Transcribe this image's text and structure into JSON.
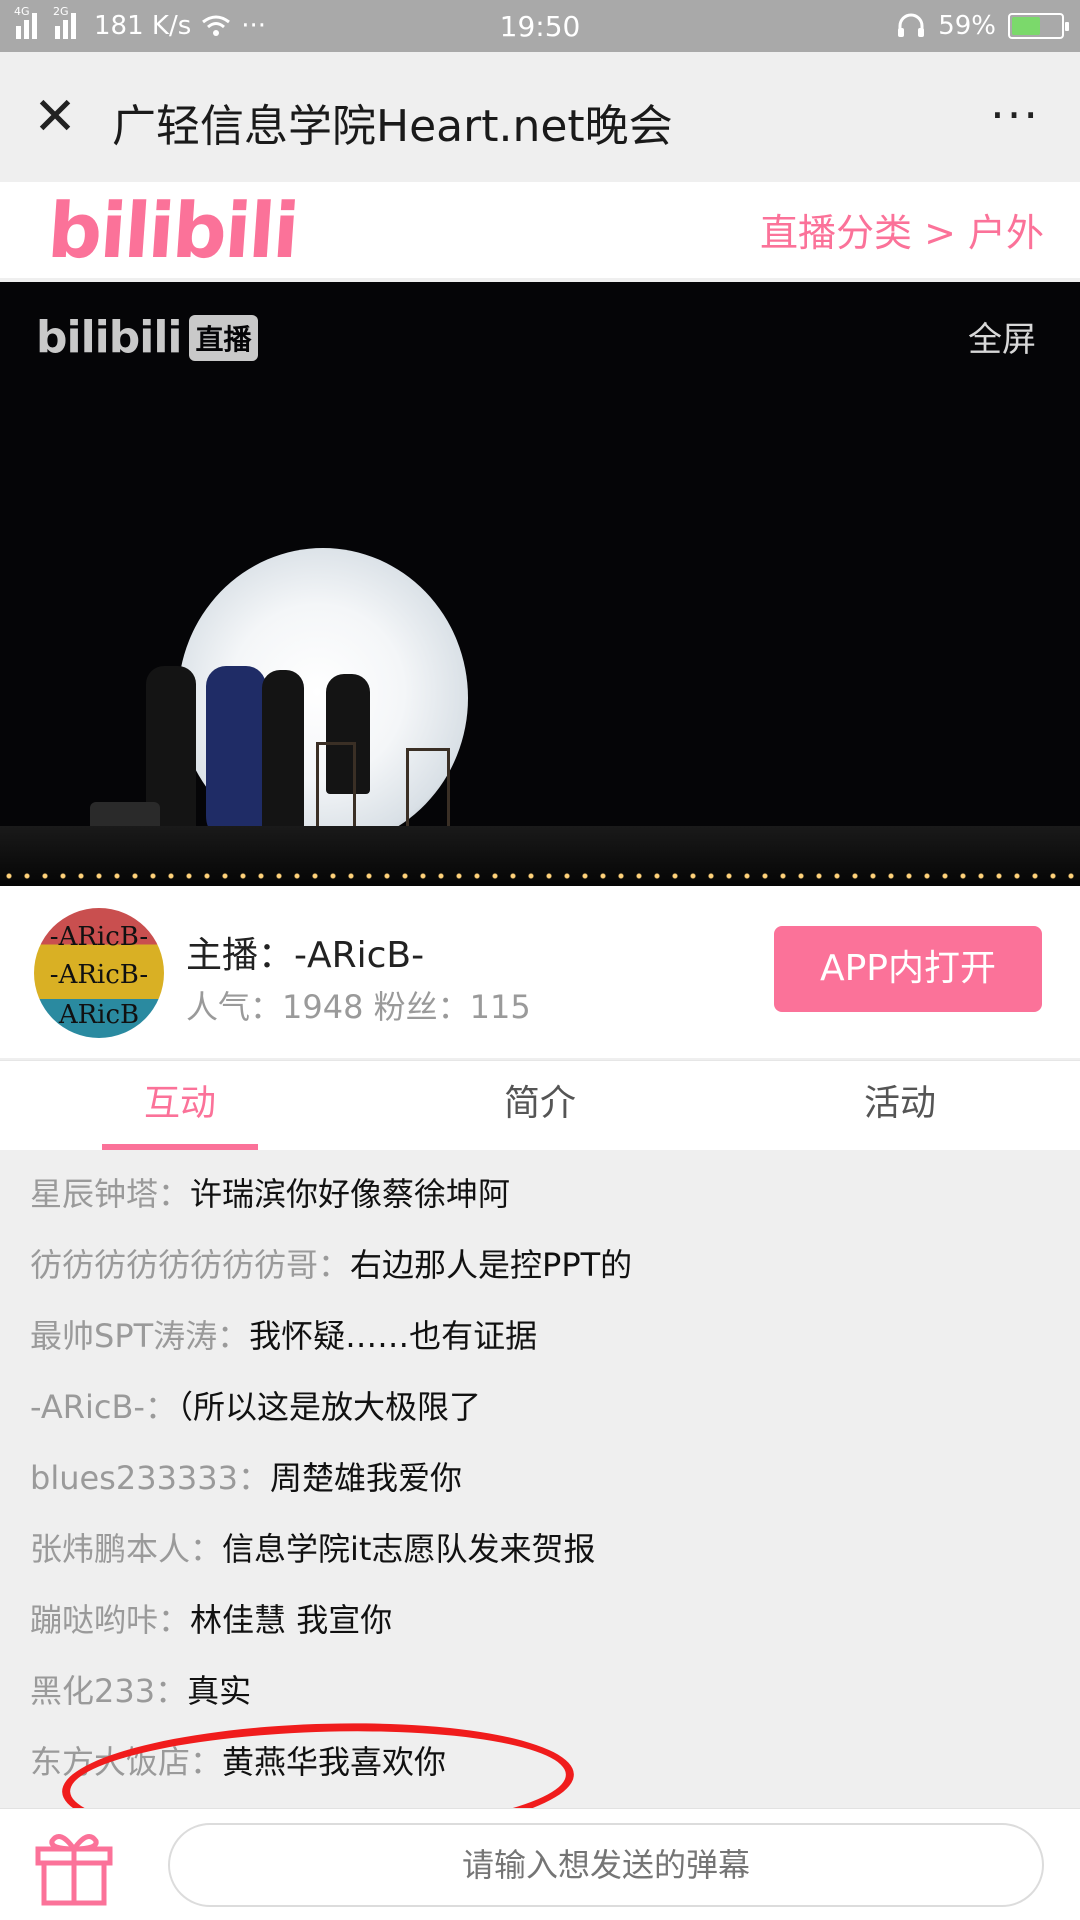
{
  "status_bar": {
    "network_1": "4G",
    "network_2": "2G",
    "speed": "181 K/s",
    "more": "···",
    "time": "19:50",
    "battery": "59%",
    "battery_level": 0.59
  },
  "title_bar": {
    "title": "广轻信息学院Heart.net晚会",
    "close": "✕",
    "more": "···"
  },
  "bili_header": {
    "logo": "bilibili",
    "category": "直播分类 > 户外"
  },
  "video": {
    "logo": "bilibili",
    "live_badge": "直播",
    "fullscreen": "全屏"
  },
  "streamer": {
    "avatar_text": [
      "-ARicB-",
      "-ARicB-",
      "ARicB"
    ],
    "anchor": "主播：-ARicB-",
    "stats": "人气：1948  粉丝：115",
    "open_app": "APP内打开"
  },
  "tabs": [
    {
      "label": "互动",
      "active": true
    },
    {
      "label": "简介",
      "active": false
    },
    {
      "label": "活动",
      "active": false
    }
  ],
  "comments": [
    {
      "user": "星辰钟塔：",
      "msg": "许瑞滨你好像蔡徐坤阿"
    },
    {
      "user": "彷彷彷彷彷彷彷彷哥：",
      "msg": "右边那人是控PPT的"
    },
    {
      "user": "最帅SPT涛涛：",
      "msg": "我怀疑……也有证据"
    },
    {
      "user": "-ARicB-：",
      "msg": "（所以这是放大极限了"
    },
    {
      "user": "blues233333：",
      "msg": "周楚雄我爱你"
    },
    {
      "user": "张炜鹏本人：",
      "msg": "信息学院it志愿队发来贺报"
    },
    {
      "user": "蹦哒哟咔：",
      "msg": "林佳慧 我宣你"
    },
    {
      "user": "黑化233：",
      "msg": "真实"
    },
    {
      "user": "东方大饭店：",
      "msg": "黄燕华我喜欢你"
    }
  ],
  "bottom_bar": {
    "input_placeholder": "请输入想发送的弹幕",
    "gift_icon": "gift-icon"
  },
  "colors": {
    "accent": "#fb7299",
    "annotation": "#f01c1c"
  }
}
